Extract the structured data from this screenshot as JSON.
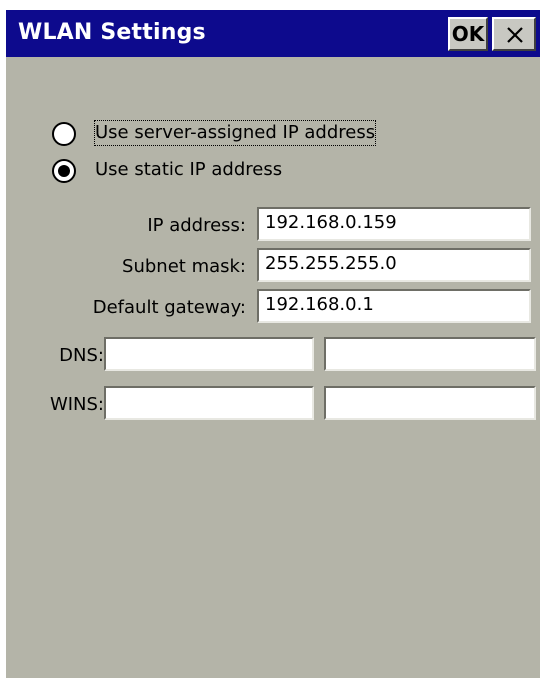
{
  "window": {
    "title": "WLAN Settings",
    "ok_label": "OK",
    "close_icon": "close-icon"
  },
  "ip_mode": {
    "options": [
      {
        "label": "Use server-assigned IP address",
        "selected": false
      },
      {
        "label": "Use static IP address",
        "selected": true
      }
    ]
  },
  "static": {
    "ip_label": "IP address:",
    "ip_value": "192.168.0.159",
    "subnet_label": "Subnet mask:",
    "subnet_value": "255.255.255.0",
    "gateway_label": "Default gateway:",
    "gateway_value": "192.168.0.1"
  },
  "dns": {
    "label": "DNS:",
    "primary": "",
    "secondary": ""
  },
  "wins": {
    "label": "WINS:",
    "primary": "",
    "secondary": ""
  },
  "colors": {
    "titlebar": "#0d0a8d",
    "background": "#b4b4a8"
  }
}
